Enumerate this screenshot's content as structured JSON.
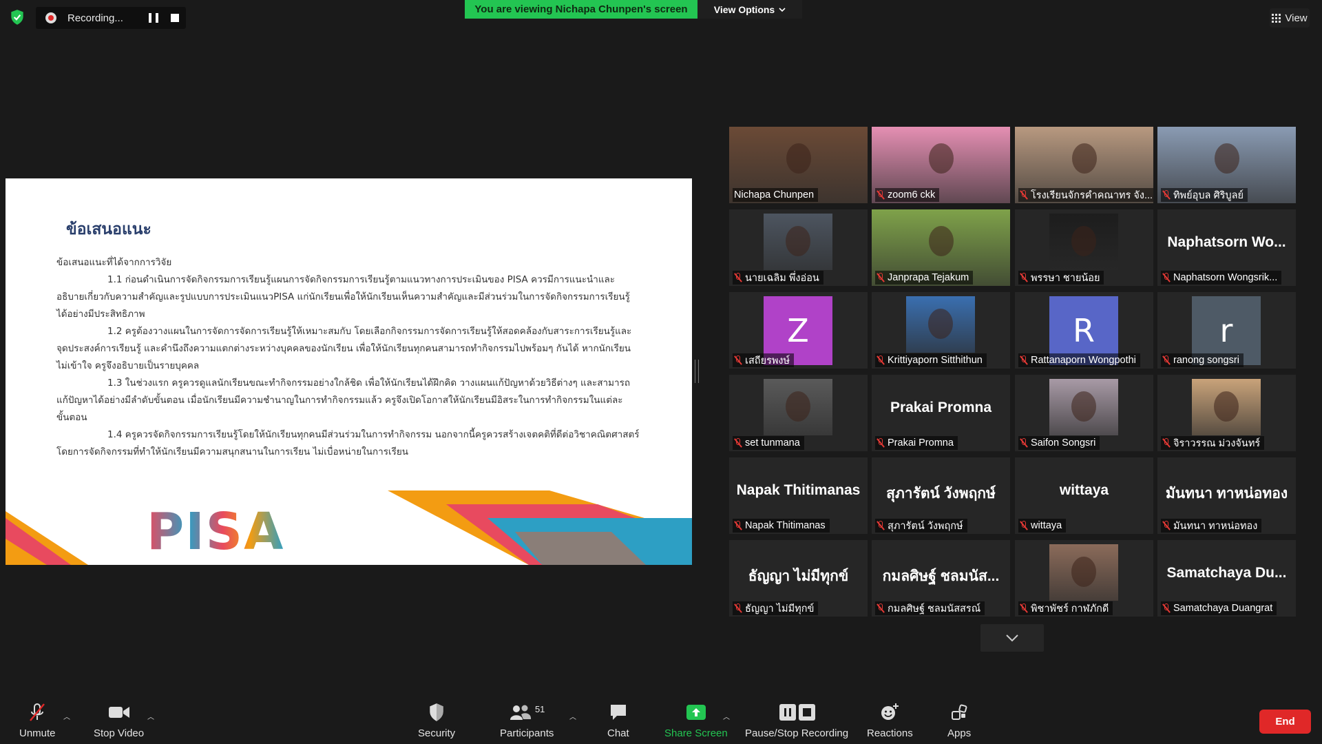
{
  "top": {
    "recording_label": "Recording...",
    "viewing_banner": "You are viewing Nichapa Chunpen's screen",
    "view_options": "View Options",
    "view_button": "View"
  },
  "slide": {
    "title": "ข้อเสนอแนะ",
    "heading": "ข้อเสนอแนะที่ได้จากการวิจัย",
    "p1": "1.1 ก่อนดำเนินการจัดกิจกรรมการเรียนรู้แผนการจัดกิจกรรมการเรียนรู้ตามแนวทางการประเมินของ PISA ควรมีการแนะนำและ",
    "p1b": "อธิบายเกี่ยวกับความสำคัญและรูปแบบการประเมินแนวPISA แก่นักเรียนเพื่อให้นักเรียนเห็นความสำคัญและมีส่วนร่วมในการจัดกิจกรรมการเรียนรู้",
    "p1c": "ได้อย่างมีประสิทธิภาพ",
    "p2": "1.2 ครูต้องวางแผนในการจัดการจัดการเรียนรู้ให้เหมาะสมกับ โดยเลือกกิจกรรมการจัดการเรียนรู้ให้สอดคล้องกับสาระการเรียนรู้และ",
    "p2b": "จุดประสงค์การเรียนรู้ และคำนึงถึงความแตกต่างระหว่างบุคคลของนักเรียน เพื่อให้นักเรียนทุกคนสามารถทำกิจกรรมไปพร้อมๆ กันได้ หากนักเรียน",
    "p2c": "ไม่เข้าใจ ครูจึงอธิบายเป็นรายบุคคล",
    "p3": "1.3 ในช่วงแรก ครูควรดูแลนักเรียนขณะทำกิจกรรมอย่างใกล้ชิด เพื่อให้นักเรียนได้ฝึกคิด วางแผนแก้ปัญหาด้วยวิธีต่างๆ และสามารถ",
    "p3b": "แก้ปัญหาได้อย่างมีลำดับขั้นตอน เมื่อนักเรียนมีความชำนาญในการทำกิจกรรมแล้ว ครูจึงเปิดโอกาสให้นักเรียนมีอิสระในการทำกิจกรรมในแต่ละ",
    "p3c": "ขั้นตอน",
    "p4": "1.4 ครูควรจัดกิจกรรมการเรียนรู้โดยให้นักเรียนทุกคนมีส่วนร่วมในการทำกิจกรรม นอกจากนี้ครูควรสร้างเจตคติที่ดีต่อวิชาคณิตศาสตร์",
    "p4b": "โดยการจัดกิจกรรมที่ทำให้นักเรียนมีความสนุกสนานในการเรียน ไม่เบื่อหน่ายในการเรียน",
    "logo": "PISA"
  },
  "participants": [
    {
      "name": "Nichapa Chunpen",
      "type": "video",
      "color": "#6b4a36",
      "active": true
    },
    {
      "name": "zoom6 ckk",
      "type": "video",
      "color": "#e58fb3"
    },
    {
      "name": "โรงเรียนจักรคำคณาทร จัง...",
      "type": "video",
      "color": "#b89980"
    },
    {
      "name": "ทิพย์อุบล ศิริบูลย์",
      "type": "video",
      "color": "#8a9bb3"
    },
    {
      "name": "นายเฉลิม พึ่งอ่อน",
      "type": "video",
      "color": "#4d5560"
    },
    {
      "name": "Janprapa Tejakum",
      "type": "video",
      "color": "#7fa24a"
    },
    {
      "name": "พรรษา ชายน้อย",
      "type": "video",
      "color": "#1d1d1d"
    },
    {
      "name": "Naphatsorn Wongsrik...",
      "type": "text",
      "big": "Naphatsorn Wo..."
    },
    {
      "name": "เสถียรพงษ์",
      "type": "letter",
      "letter": "Z",
      "color": "#b042c8"
    },
    {
      "name": "Krittiyaporn Sitthithun",
      "type": "video",
      "color": "#3a6fb0"
    },
    {
      "name": "Rattanaporn Wongpothi",
      "type": "letter",
      "letter": "R",
      "color": "#5866c7"
    },
    {
      "name": "ranong songsri",
      "type": "letter",
      "letter": "r",
      "color": "#4e5a66"
    },
    {
      "name": "set tunmana",
      "type": "video",
      "color": "#5a5a5a"
    },
    {
      "name": "Prakai Promna",
      "type": "text",
      "big": "Prakai Promna"
    },
    {
      "name": "Saifon Songsri",
      "type": "video",
      "color": "#a89aa6"
    },
    {
      "name": "จิราวรรณ ม่วงจันทร์",
      "type": "video",
      "color": "#c9a37a"
    },
    {
      "name": "Napak Thitimanas",
      "type": "text",
      "big": "Napak Thitimanas"
    },
    {
      "name": "สุภารัตน์ วังพฤกษ์",
      "type": "text",
      "big": "สุภารัตน์ วังพฤกษ์"
    },
    {
      "name": "wittaya",
      "type": "text",
      "big": "wittaya"
    },
    {
      "name": "มันทนา ทาหน่อทอง",
      "type": "text",
      "big": "มันทนา ทาหน่อทอง"
    },
    {
      "name": "ธัญญา ไม่มีทุกข์",
      "type": "text",
      "big": "ธัญญา  ไม่มีทุกข์"
    },
    {
      "name": "กมลศิษฐ์ ชลมนัสสรณ์",
      "type": "text",
      "big": "กมลศิษฐ์ ชลมนัส..."
    },
    {
      "name": "พิชาพัชร์ กาฬภักดี",
      "type": "video",
      "color": "#8b6b5a"
    },
    {
      "name": "Samatchaya Duangrat",
      "type": "text",
      "big": "Samatchaya  Du..."
    }
  ],
  "toolbar": {
    "unmute": "Unmute",
    "stop_video": "Stop Video",
    "security": "Security",
    "participants": "Participants",
    "participant_count": "51",
    "chat": "Chat",
    "share_screen": "Share Screen",
    "pause_stop_recording": "Pause/Stop Recording",
    "reactions": "Reactions",
    "apps": "Apps",
    "end": "End"
  },
  "colors": {
    "banner_green": "#23c552",
    "end_red": "#e02828",
    "active_speaker": "#d9ed6a"
  }
}
